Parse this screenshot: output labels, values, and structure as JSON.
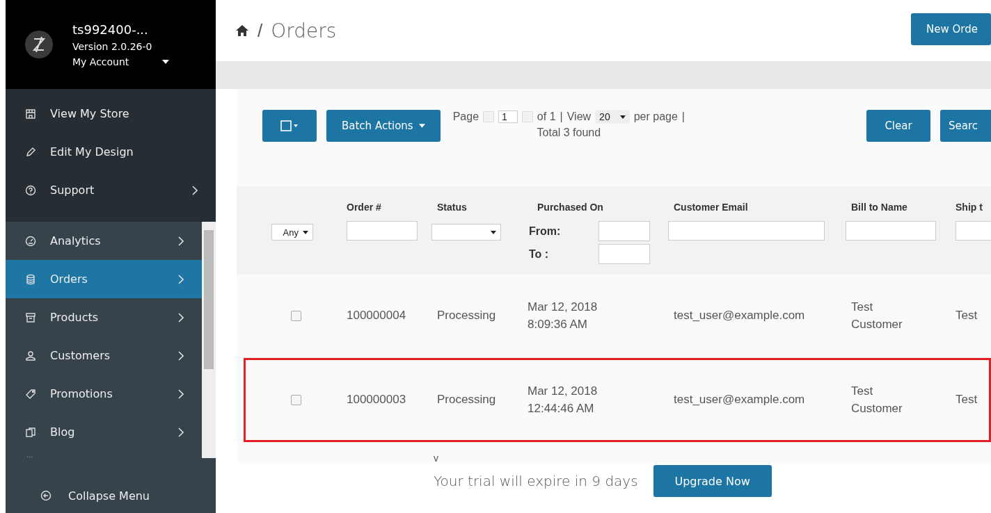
{
  "account": {
    "name": "ts992400-...",
    "version": "Version 2.0.26-0",
    "menu": "My Account"
  },
  "sidebar": {
    "top_items": [
      {
        "label": "View My Store",
        "submenu": false,
        "selected": false
      },
      {
        "label": "Edit My Design",
        "submenu": false,
        "selected": false
      },
      {
        "label": "Support",
        "submenu": true,
        "selected": false
      }
    ],
    "items": [
      {
        "label": "Analytics",
        "submenu": true,
        "selected": false
      },
      {
        "label": "Orders",
        "submenu": true,
        "selected": true
      },
      {
        "label": "Products",
        "submenu": true,
        "selected": false
      },
      {
        "label": "Customers",
        "submenu": true,
        "selected": false
      },
      {
        "label": "Promotions",
        "submenu": true,
        "selected": false
      },
      {
        "label": "Blog",
        "submenu": true,
        "selected": false
      }
    ],
    "more": "...",
    "collapse": "Collapse Menu"
  },
  "breadcrumb": {
    "current": "Orders",
    "separator": "/"
  },
  "new_button": "New Orde",
  "toolbar": {
    "batch": "Batch Actions",
    "page_label": "Page",
    "page": "1",
    "of": "of 1",
    "sep1": "|",
    "view": "View",
    "per_page_value": "20",
    "per_page": "per page",
    "sep2": "|",
    "total": "Total 3 found",
    "clear": "Clear",
    "search": "Searc"
  },
  "table": {
    "columns": [
      "Order #",
      "Status",
      "Purchased On",
      "Customer Email",
      "Bill to Name",
      "Ship t"
    ],
    "filters": {
      "any": "Any",
      "from": "From:",
      "to": "To :"
    },
    "rows": [
      {
        "checked": false,
        "highlighted": false,
        "order": "100000004",
        "status": "Processing",
        "date": "Mar 12, 2018",
        "time": "8:09:36 AM",
        "email": "test_user@example.com",
        "bill_first": "Test",
        "bill_last": "Customer",
        "ship": "Test"
      },
      {
        "checked": false,
        "highlighted": true,
        "order": "100000003",
        "status": "Processing",
        "date": "Mar 12, 2018",
        "time": "12:44:46 AM",
        "email": "test_user@example.com",
        "bill_first": "Test",
        "bill_last": "Customer",
        "ship": "Test"
      }
    ]
  },
  "more_toggle": "v",
  "trial": {
    "text": "Your trial will expire in 9 days",
    "button": "Upgrade Now"
  }
}
